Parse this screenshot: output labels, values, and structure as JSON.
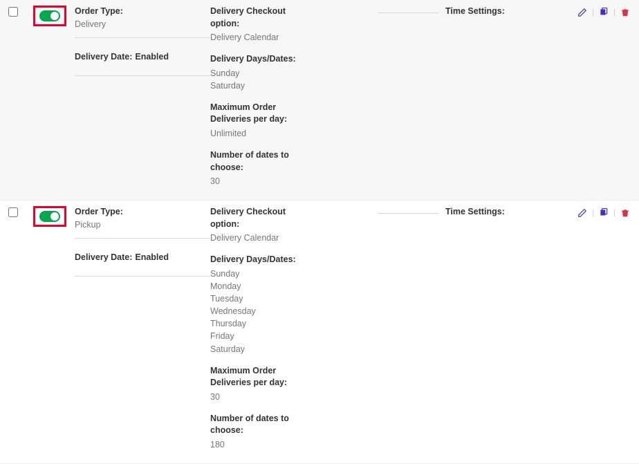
{
  "labels": {
    "order_type": "Order Type:",
    "delivery_date": "Delivery Date:",
    "checkout_option": "Delivery Checkout option:",
    "delivery_days": "Delivery Days/Dates:",
    "max_per_day": "Maximum Order Deliveries per day:",
    "num_dates": "Number of dates to choose:",
    "time_settings": "Time Settings:"
  },
  "rows": [
    {
      "order_type": "Delivery",
      "delivery_date_status": "Enabled",
      "checkout_option": "Delivery Calendar",
      "days_line1": "Sunday",
      "days_line2": "Saturday",
      "days_line3": "",
      "days_line4": "",
      "days_line5": "",
      "days_line6": "",
      "days_line7": "",
      "max_per_day": "Unlimited",
      "num_dates": "30"
    },
    {
      "order_type": "Pickup",
      "delivery_date_status": "Enabled",
      "checkout_option": "Delivery Calendar",
      "days_line1": "Sunday",
      "days_line2": "Monday",
      "days_line3": "Tuesday",
      "days_line4": "Wednesday",
      "days_line5": "Thursday",
      "days_line6": "Friday",
      "days_line7": "Saturday",
      "max_per_day": "30",
      "num_dates": "180"
    }
  ]
}
